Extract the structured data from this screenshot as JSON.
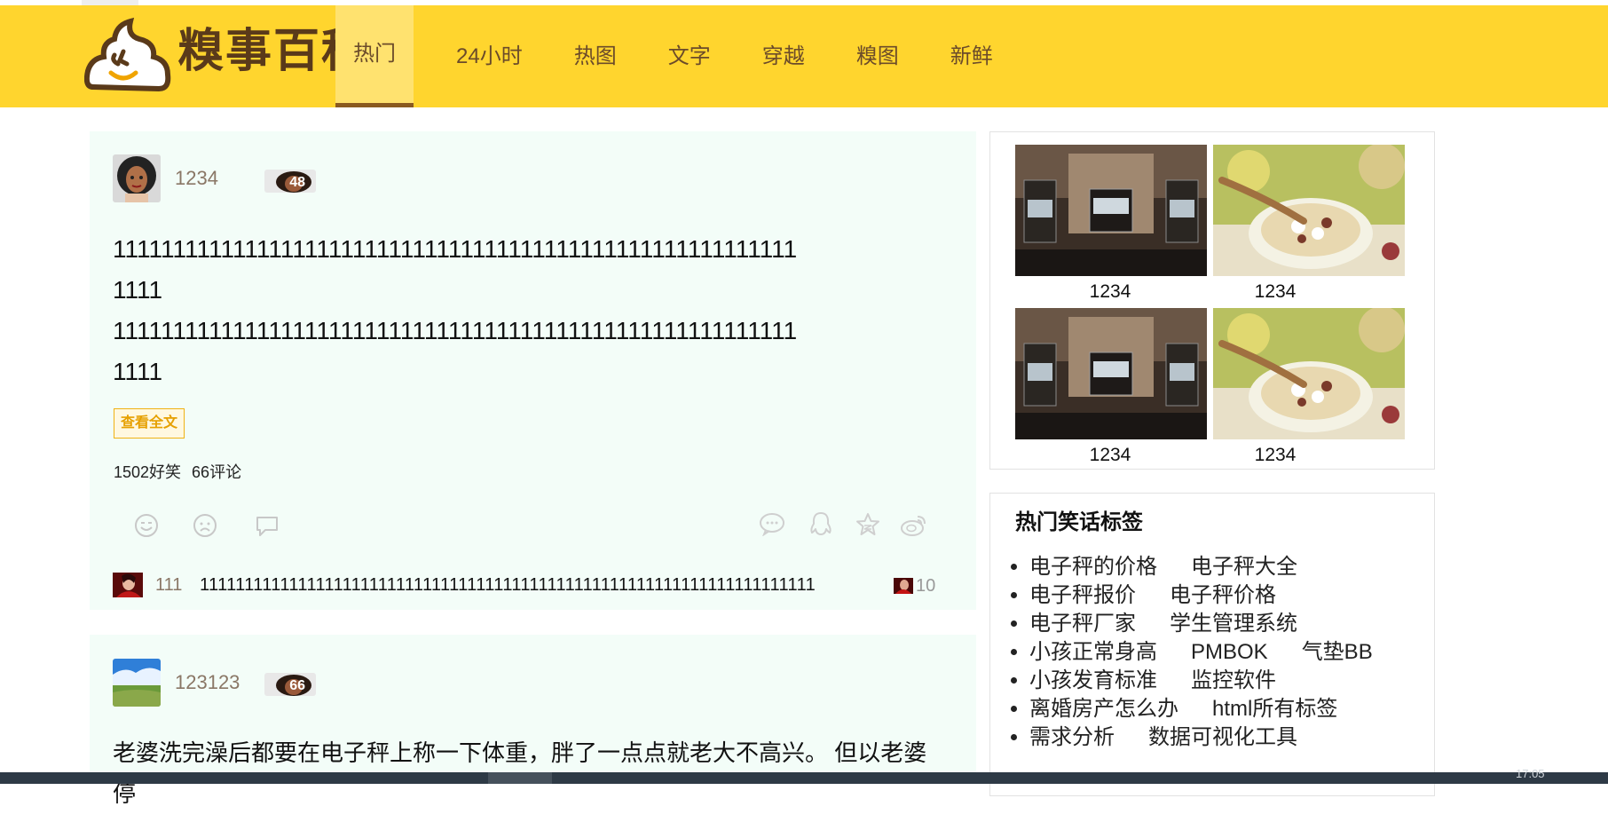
{
  "header": {
    "logo_text": "糗事百科",
    "nav": [
      {
        "label": "热门",
        "active": true
      },
      {
        "label": "24小时"
      },
      {
        "label": "热图"
      },
      {
        "label": "文字"
      },
      {
        "label": "穿越"
      },
      {
        "label": "糗图"
      },
      {
        "label": "新鲜"
      }
    ],
    "brand_color": "#ffd52e"
  },
  "posts": [
    {
      "author": "1234",
      "age": "48",
      "content_lines": [
        "111111111111111111111111111111111111111111111111111111111",
        "1111",
        "111111111111111111111111111111111111111111111111111111111",
        "1111"
      ],
      "read_more": "查看全文",
      "funny_count": "1502好笑",
      "comment_count": "66评论",
      "top_comment": {
        "user": "111",
        "text": "111111111111111111111111111111111111111111111111111111111111111111111",
        "likes": "10"
      }
    },
    {
      "author": "123123",
      "age": "66",
      "content_lines": [
        "老婆洗完澡后都要在电子秤上称一下体重，胖了一点点就老大不高兴。 但以老婆停"
      ]
    }
  ],
  "sidebar": {
    "images": [
      {
        "caption": "1234",
        "icon": "showroom-photo"
      },
      {
        "caption": "1234",
        "icon": "soup-photo"
      },
      {
        "caption": "1234",
        "icon": "showroom-photo"
      },
      {
        "caption": "1234",
        "icon": "soup-photo"
      }
    ],
    "tags_title": "热门笑话标签",
    "tag_rows": [
      [
        "电子秤的价格",
        "电子秤大全"
      ],
      [
        "电子秤报价",
        "电子秤价格"
      ],
      [
        "电子秤厂家",
        "学生管理系统"
      ],
      [
        "小孩正常身高",
        "PMBOK",
        "气垫BB"
      ],
      [
        "小孩发育标准",
        "监控软件"
      ],
      [
        "离婚房产怎么办",
        "html所有标签"
      ],
      [
        "需求分析",
        "数据可视化工具"
      ]
    ]
  },
  "taskbar": {
    "clock": "17:05"
  }
}
